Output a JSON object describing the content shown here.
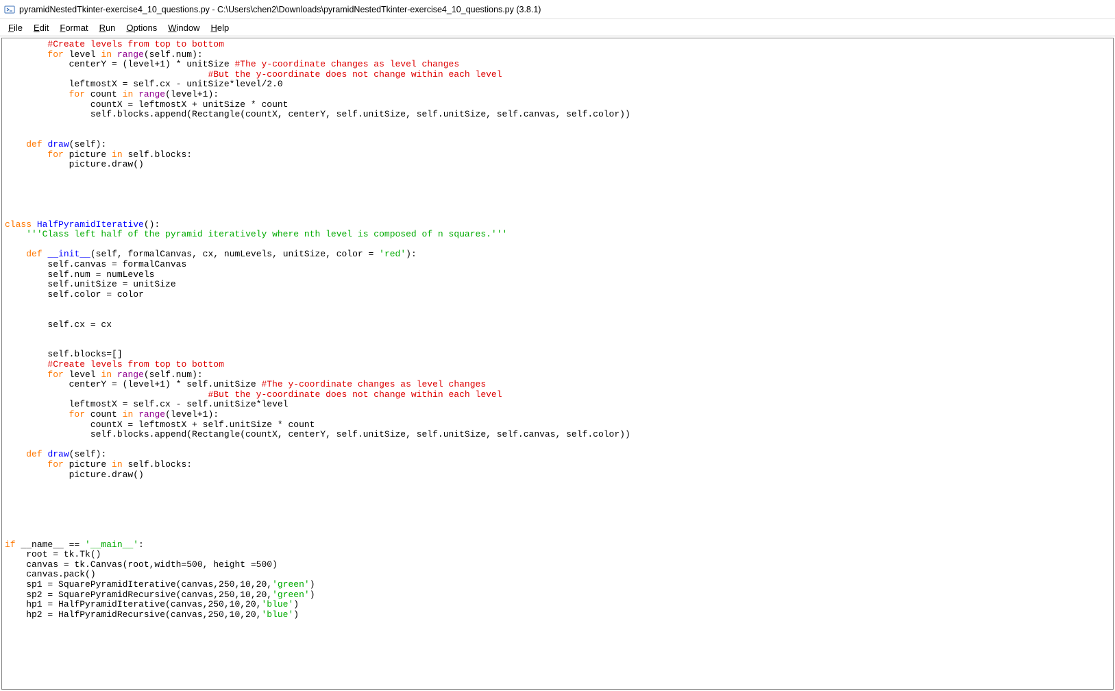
{
  "titlebar": {
    "text": "pyramidNestedTkinter-exercise4_10_questions.py - C:\\Users\\chen2\\Downloads\\pyramidNestedTkinter-exercise4_10_questions.py (3.8.1)"
  },
  "menu": {
    "file": {
      "ul": "F",
      "rest": "ile"
    },
    "edit": {
      "ul": "E",
      "rest": "dit"
    },
    "format": {
      "ul": "F",
      "rest": "ormat"
    },
    "run": {
      "ul": "R",
      "rest": "un"
    },
    "options": {
      "ul": "O",
      "rest": "ptions"
    },
    "window": {
      "ul": "W",
      "rest": "indow"
    },
    "help": {
      "ul": "H",
      "rest": "elp"
    }
  },
  "code": {
    "l01a": "        ",
    "l01b": "#Create levels from top to bottom",
    "l02a": "        ",
    "l02b": "for",
    "l02c": " level ",
    "l02d": "in",
    "l02e": " ",
    "l02f": "range",
    "l02g": "(self.num):",
    "l03a": "            centerY = (level+1) * unitSize ",
    "l03b": "#The y-coordinate changes as level changes",
    "l04a": "                                      ",
    "l04b": "#But the y-coordinate does not change within each level",
    "l05": "            leftmostX = self.cx - unitSize*level/2.0",
    "l06a": "            ",
    "l06b": "for",
    "l06c": " count ",
    "l06d": "in",
    "l06e": " ",
    "l06f": "range",
    "l06g": "(level+1):",
    "l07": "                countX = leftmostX + unitSize * count",
    "l08": "                self.blocks.append(Rectangle(countX, centerY, self.unitSize, self.unitSize, self.canvas, self.color))",
    "l09": "",
    "l10": "",
    "l11a": "    ",
    "l11b": "def",
    "l11c": " ",
    "l11d": "draw",
    "l11e": "(self):",
    "l12a": "        ",
    "l12b": "for",
    "l12c": " picture ",
    "l12d": "in",
    "l12e": " self.blocks:",
    "l13": "            picture.draw()",
    "l14": "",
    "l15": "",
    "l16": "",
    "l17": "",
    "l18": "",
    "l19a": "class",
    "l19b": " ",
    "l19c": "HalfPyramidIterative",
    "l19d": "():",
    "l20a": "    ",
    "l20b": "'''Class left half of the pyramid iteratively where nth level is composed of n squares.'''",
    "l21": "",
    "l22a": "    ",
    "l22b": "def",
    "l22c": " ",
    "l22d": "__init__",
    "l22e": "(self, formalCanvas, cx, numLevels, unitSize, color = ",
    "l22f": "'red'",
    "l22g": "):",
    "l23": "        self.canvas = formalCanvas",
    "l24": "        self.num = numLevels",
    "l25": "        self.unitSize = unitSize",
    "l26": "        self.color = color",
    "l27": "",
    "l28": "",
    "l29": "        self.cx = cx",
    "l30": "",
    "l31": "",
    "l32": "        self.blocks=[]",
    "l33a": "        ",
    "l33b": "#Create levels from top to bottom",
    "l34a": "        ",
    "l34b": "for",
    "l34c": " level ",
    "l34d": "in",
    "l34e": " ",
    "l34f": "range",
    "l34g": "(self.num):",
    "l35a": "            centerY = (level+1) * self.unitSize ",
    "l35b": "#The y-coordinate changes as level changes",
    "l36a": "                                      ",
    "l36b": "#But the y-coordinate does not change within each level",
    "l37": "            leftmostX = self.cx - self.unitSize*level",
    "l38a": "            ",
    "l38b": "for",
    "l38c": " count ",
    "l38d": "in",
    "l38e": " ",
    "l38f": "range",
    "l38g": "(level+1):",
    "l39": "                countX = leftmostX + self.unitSize * count",
    "l40": "                self.blocks.append(Rectangle(countX, centerY, self.unitSize, self.unitSize, self.canvas, self.color))",
    "l41": "",
    "l42a": "    ",
    "l42b": "def",
    "l42c": " ",
    "l42d": "draw",
    "l42e": "(self):",
    "l43a": "        ",
    "l43b": "for",
    "l43c": " picture ",
    "l43d": "in",
    "l43e": " self.blocks:",
    "l44": "            picture.draw()",
    "l45": "",
    "l46": "",
    "l47": "",
    "l48": "",
    "l49": "",
    "l50": "",
    "l51a": "if",
    "l51b": " __name__ == ",
    "l51c": "'__main__'",
    "l51d": ":",
    "l52": "    root = tk.Tk()",
    "l53": "    canvas = tk.Canvas(root,width=500, height =500)",
    "l54": "    canvas.pack()",
    "l55a": "    sp1 = SquarePyramidIterative(canvas,250,10,20,",
    "l55b": "'green'",
    "l55c": ")",
    "l56a": "    sp2 = SquarePyramidRecursive(canvas,250,10,20,",
    "l56b": "'green'",
    "l56c": ")",
    "l57a": "    hp1 = HalfPyramidIterative(canvas,250,10,20,",
    "l57b": "'blue'",
    "l57c": ")",
    "l58a": "    hp2 = HalfPyramidRecursive(canvas,250,10,20,",
    "l58b": "'blue'",
    "l58c": ")"
  }
}
